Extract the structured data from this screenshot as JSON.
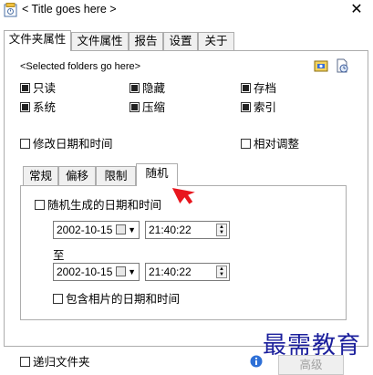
{
  "window": {
    "title": "< Title goes here >",
    "close_glyph": "✕"
  },
  "tabs": [
    {
      "label": "文件夹属性",
      "active": true
    },
    {
      "label": "文件属性",
      "active": false
    },
    {
      "label": "报告",
      "active": false
    },
    {
      "label": "设置",
      "active": false
    },
    {
      "label": "关于",
      "active": false
    }
  ],
  "folder_section": {
    "selected_text": "<Selected folders go here>"
  },
  "attributes": [
    {
      "label": "只读",
      "checked": "indeterminate"
    },
    {
      "label": "隐藏",
      "checked": "indeterminate"
    },
    {
      "label": "存档",
      "checked": "indeterminate"
    },
    {
      "label": "系统",
      "checked": "indeterminate"
    },
    {
      "label": "压缩",
      "checked": "indeterminate"
    },
    {
      "label": "索引",
      "checked": "indeterminate"
    }
  ],
  "modify_datetime": {
    "label": "修改日期和时间",
    "checked": false
  },
  "relative_adjust": {
    "label": "相对调整",
    "checked": false
  },
  "inner_tabs": [
    {
      "label": "常规",
      "active": false
    },
    {
      "label": "偏移",
      "active": false
    },
    {
      "label": "限制",
      "active": false
    },
    {
      "label": "随机",
      "active": true
    }
  ],
  "random": {
    "generate_label": "随机生成的日期和时间",
    "generate_checked": false,
    "from_date": "2002-10-15",
    "from_time": "21:40:22",
    "to_label": "至",
    "to_date": "2002-10-15",
    "to_time": "21:40:22",
    "include_photos_label": "包含相片的日期和时间",
    "include_photos_checked": false
  },
  "bottom": {
    "recursive_label": "递归文件夹",
    "recursive_checked": false,
    "advanced_label": "高级"
  },
  "watermark": "最需教育",
  "colors": {
    "pointer_arrow": "#e8161e",
    "watermark": "#1b1f9c"
  }
}
